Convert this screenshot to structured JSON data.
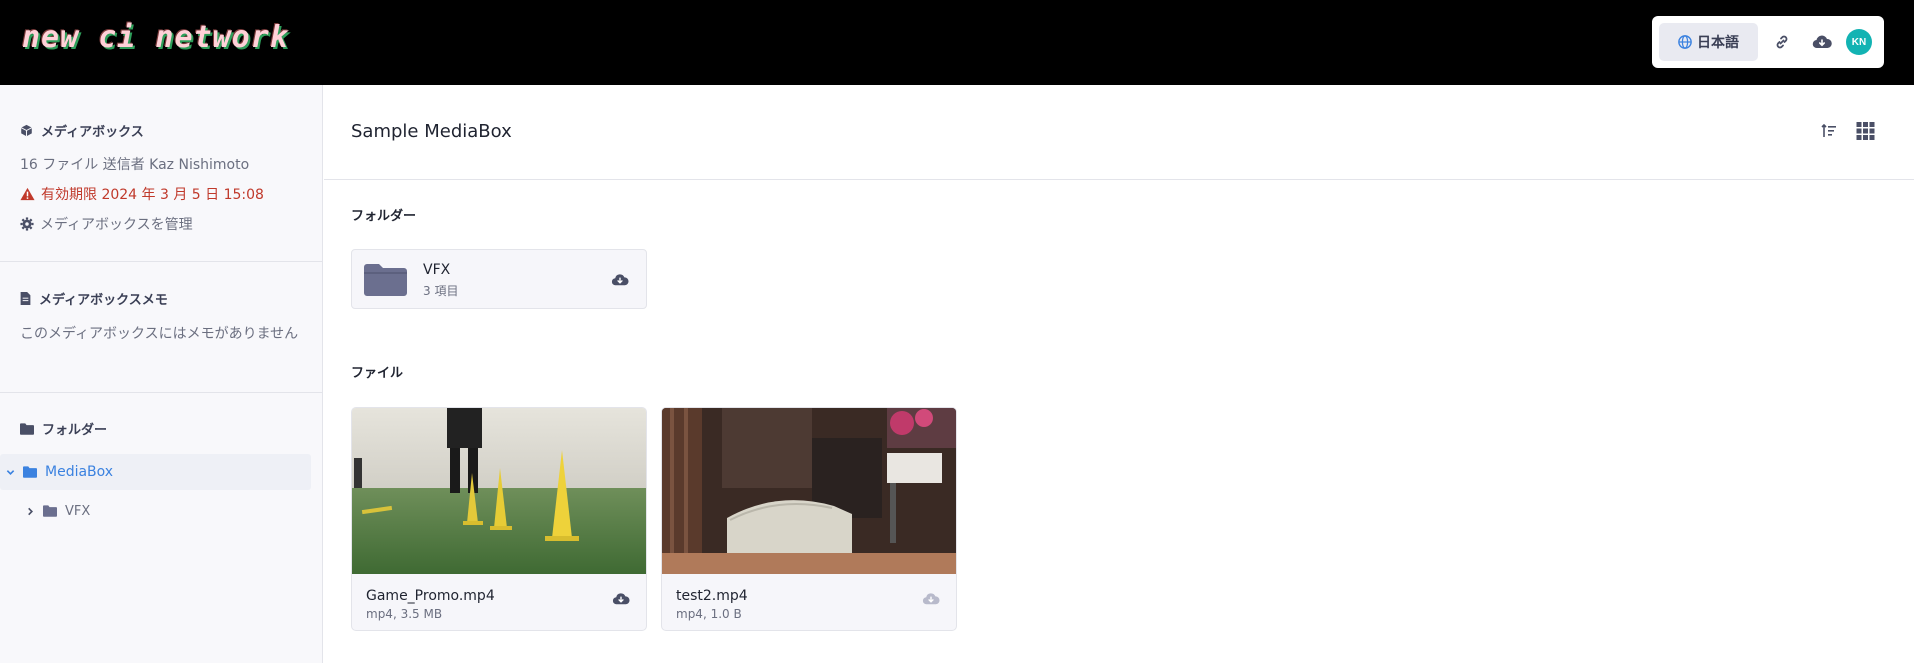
{
  "topbar": {
    "logo": "new ci network",
    "lang_label": "日本語",
    "avatar_initials": "KN",
    "icons": [
      "globe-icon",
      "link-icon",
      "cloud-download-icon"
    ]
  },
  "sidebar": {
    "mediabox": {
      "title": "メディアボックス",
      "summary": "16 ファイル 送信者 Kaz Nishimoto",
      "expiry": "有効期限 2024 年 3 月 5 日 15:08",
      "manage": "メディアボックスを管理"
    },
    "memo": {
      "title": "メディアボックスメモ",
      "text": "このメディアボックスにはメモがありません"
    },
    "folders": {
      "title": "フォルダー",
      "tree": [
        {
          "label": "MediaBox",
          "expanded": true
        },
        {
          "label": "VFX",
          "expanded": false
        }
      ]
    }
  },
  "main": {
    "title": "Sample MediaBox",
    "folders_label": "フォルダー",
    "files_label": "ファイル",
    "folder": {
      "name": "VFX",
      "count": "3 項目"
    },
    "files": [
      {
        "name": "Game_Promo.mp4",
        "meta": "mp4, 3.5 MB"
      },
      {
        "name": "test2.mp4",
        "meta": "mp4, 1.0 B"
      }
    ]
  },
  "colors": {
    "accent": "#3b82e0",
    "warning": "#c0392b",
    "avatar": "#12b3b3",
    "folder": "#6b6f8f"
  }
}
